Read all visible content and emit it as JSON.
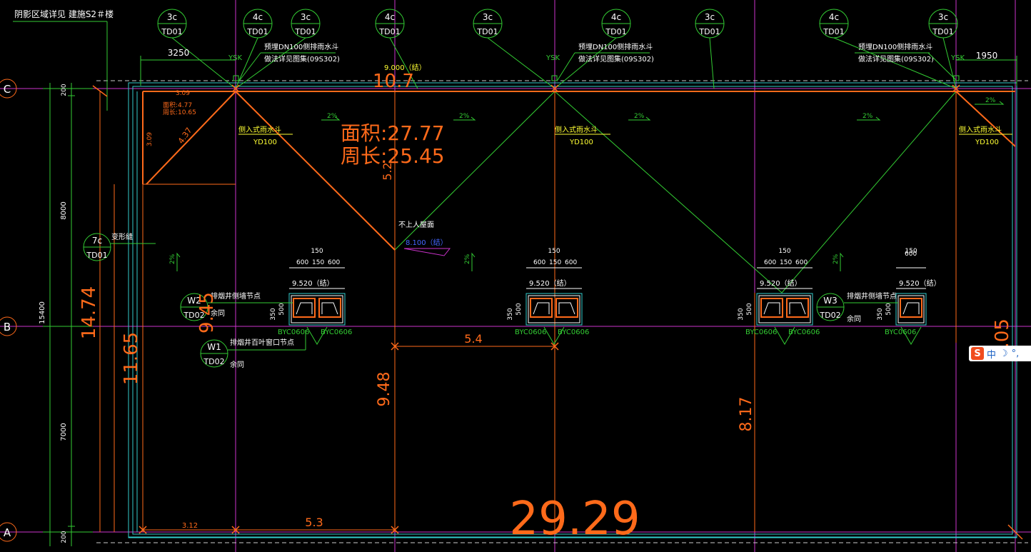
{
  "header_note": "阴影区域详见 建施S2＃楼",
  "bubbles_top": [
    {
      "num": "3c",
      "ref": "TD01"
    },
    {
      "num": "4c",
      "ref": "TD01"
    },
    {
      "num": "3c",
      "ref": "TD01"
    },
    {
      "num": "4c",
      "ref": "TD01"
    },
    {
      "num": "3c",
      "ref": "TD01"
    },
    {
      "num": "4c",
      "ref": "TD01"
    },
    {
      "num": "3c",
      "ref": "TD01"
    },
    {
      "num": "4c",
      "ref": "TD01"
    },
    {
      "num": "3c",
      "ref": "TD01"
    }
  ],
  "bubble_left": {
    "num": "7c",
    "ref": "TD01",
    "label": "变形缝"
  },
  "detail_bubbles": [
    {
      "num": "W2",
      "ref": "TD02",
      "title": "排烟井侧墙节点",
      "note": "余同"
    },
    {
      "num": "W1",
      "ref": "TD02",
      "title": "排烟井百叶窗口节点",
      "note": "余同"
    },
    {
      "num": "W3",
      "ref": "TD02",
      "title": "排烟井侧墙节点",
      "note": "余同"
    }
  ],
  "axes": {
    "c": "C",
    "b": "B",
    "a": "A"
  },
  "dims_top": {
    "left": "3250",
    "right": "1950"
  },
  "dims_left": {
    "d1": "200",
    "d2": "8000",
    "d3": "7000",
    "d4": "200",
    "total": "15400"
  },
  "drain_notes": [
    {
      "line1": "预埋DN100侧排雨水斗",
      "line2": "做法详见图集(09S302)"
    },
    {
      "line1": "预埋DN100侧排雨水斗",
      "line2": "做法详见图集(09S302)"
    },
    {
      "line1": "预埋DN100侧排雨水斗",
      "line2": "做法详见图集(09S302)"
    }
  ],
  "ysk": "YSK",
  "roof_drain": {
    "label": "侧入式雨水斗",
    "code": "YD100"
  },
  "elev_top": "9.000（结）",
  "area_text": {
    "area": "面积:27.77",
    "perimeter": "周长:25.45"
  },
  "corner_text": {
    "area": "面积:4.77",
    "perimeter": "周长:10.65",
    "d1": "3.09",
    "d2": "3.09",
    "d3": "4.37"
  },
  "roof_note": "不上人屋面",
  "roof_elev": "8.100（结）",
  "slopes": [
    "2%",
    "2%",
    "2%",
    "2%",
    "2%",
    "2%",
    "2%",
    "2%"
  ],
  "shaft_dims": {
    "a": "150",
    "b": "600",
    "c": "150",
    "d": "600"
  },
  "shaft_elev": "9.520（结）",
  "shaft_side": {
    "a": "350",
    "b": "500"
  },
  "vents": [
    "BYC0606",
    "BYC0606"
  ],
  "measures": {
    "m_10_7": "10.7",
    "m_5_2": "5.2",
    "m_14_74": "14.74",
    "m_11_65": "11.65",
    "m_9_45": "9.45",
    "m_5_4": "5.4",
    "m_9_48": "9.48",
    "m_8_17": "8.17",
    "m_1_05": "1.05",
    "m_29_29": "29.29",
    "m_3_12": "3.12",
    "m_5_3": "5.3"
  },
  "ime": {
    "label": "中",
    "moon": "☽",
    "dots": "°,"
  },
  "colors": {
    "bg": "#000000",
    "magenta": "#cc33cc",
    "green": "#33cc33",
    "cyan": "#33cccc",
    "orange": "#ff6a1a",
    "yellow": "#ffff33",
    "white": "#ffffff",
    "blue": "#4466ff"
  }
}
